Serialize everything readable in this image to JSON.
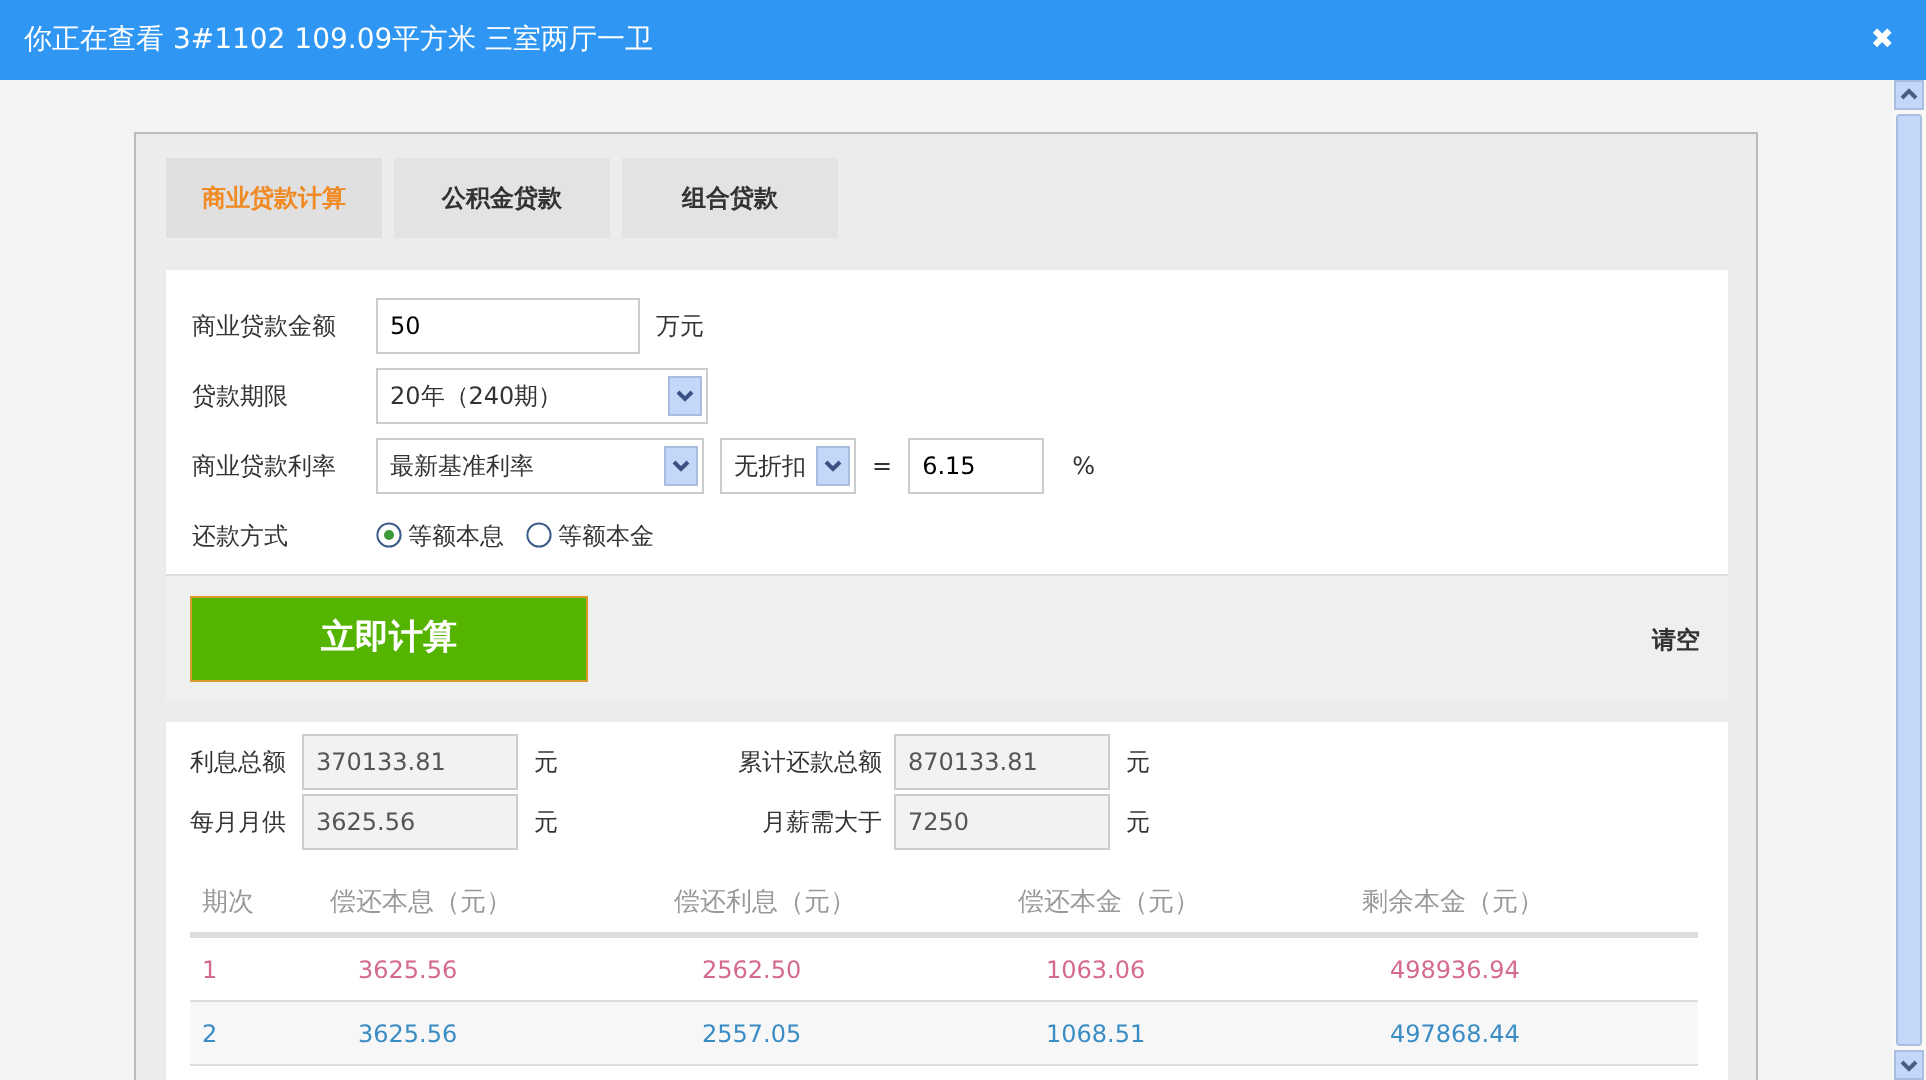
{
  "window": {
    "title": "你正在查看 3#1102 109.09平方米 三室两厅一卫",
    "close": "✖"
  },
  "tabs": [
    {
      "label": "商业贷款计算",
      "selected": true
    },
    {
      "label": "公积金贷款",
      "selected": false
    },
    {
      "label": "组合贷款",
      "selected": false
    }
  ],
  "form": {
    "amount": {
      "label": "商业贷款金额",
      "value": "50",
      "unit": "万元"
    },
    "term": {
      "label": "贷款期限",
      "value": "20年（240期）"
    },
    "rate": {
      "label": "商业贷款利率",
      "value": "最新基准利率",
      "discount": "无折扣",
      "equals": "=",
      "result": "6.15",
      "unit": "%"
    },
    "method": {
      "label": "还款方式",
      "options": [
        {
          "label": "等额本息",
          "selected": true
        },
        {
          "label": "等额本金",
          "selected": false
        }
      ]
    }
  },
  "actions": {
    "calculate": "立即计算",
    "clear": "请空"
  },
  "summary": [
    {
      "label": "利息总额",
      "value": "370133.81",
      "unit": "元"
    },
    {
      "label": "累计还款总额",
      "value": "870133.81",
      "unit": "元"
    },
    {
      "label": "每月月供",
      "value": "3625.56",
      "unit": "元"
    },
    {
      "label": "月薪需大于",
      "value": "7250",
      "unit": "元"
    }
  ],
  "table": {
    "columns": [
      "期次",
      "偿还本息（元）",
      "偿还利息（元）",
      "偿还本金（元）",
      "剩余本金（元）"
    ],
    "rows": [
      {
        "color": "#d46a90",
        "cells": [
          "1",
          "3625.56",
          "2562.50",
          "1063.06",
          "498936.94"
        ]
      },
      {
        "color": "#3a8cc4",
        "cells": [
          "2",
          "3625.56",
          "2557.05",
          "1068.51",
          "497868.44"
        ]
      }
    ]
  }
}
